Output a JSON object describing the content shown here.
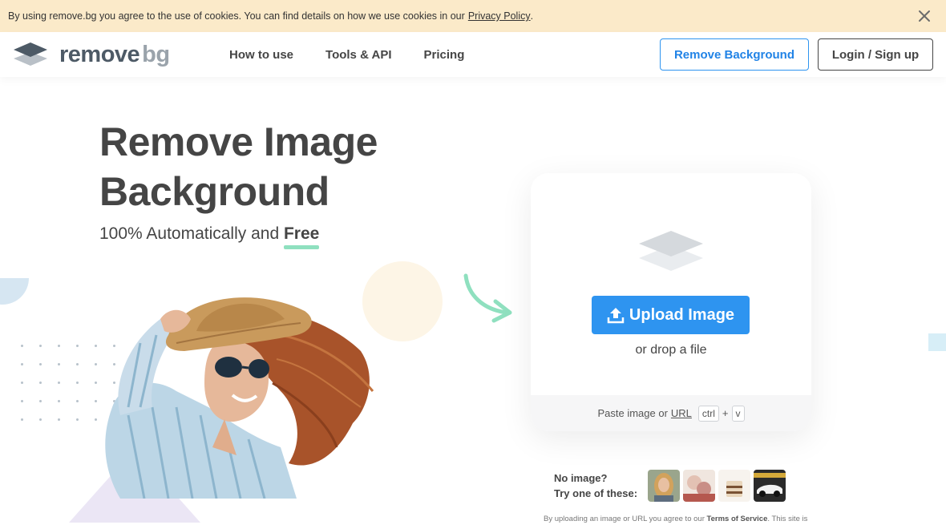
{
  "cookie_banner": {
    "text": "By using remove.bg you agree to the use of cookies. You can find details on how we use cookies in our",
    "link": "Privacy Policy",
    "period": ".",
    "close_icon": "close-icon",
    "background": "#fbeac9"
  },
  "header": {
    "logo_text_1": "remove",
    "logo_text_2": "bg",
    "nav": [
      "How to use",
      "Tools & API",
      "Pricing"
    ],
    "cta_remove": "Remove Background",
    "cta_login": "Login / Sign up"
  },
  "hero": {
    "title_line1": "Remove Image",
    "title_line2": "Background",
    "subtitle_prefix": "100% Automatically and",
    "subtitle_emphasis": "Free"
  },
  "upload": {
    "button_label": "Upload Image",
    "drop_text": "or drop a file",
    "paste_text": "Paste image or",
    "paste_link": "URL",
    "key_ctrl": "ctrl",
    "key_plus": "+",
    "key_v": "v"
  },
  "samples": {
    "line1": "No image?",
    "line2": "Try one of these:",
    "items": [
      "woman-portrait",
      "food-plate",
      "cake",
      "car"
    ]
  },
  "footer": {
    "text_before": "By uploading an image or URL you agree to our",
    "terms": "Terms of Service",
    "text_after": ". This site is"
  },
  "colors": {
    "accent": "#2e94f0",
    "headline": "#454545",
    "underline": "#8fe0bf"
  }
}
